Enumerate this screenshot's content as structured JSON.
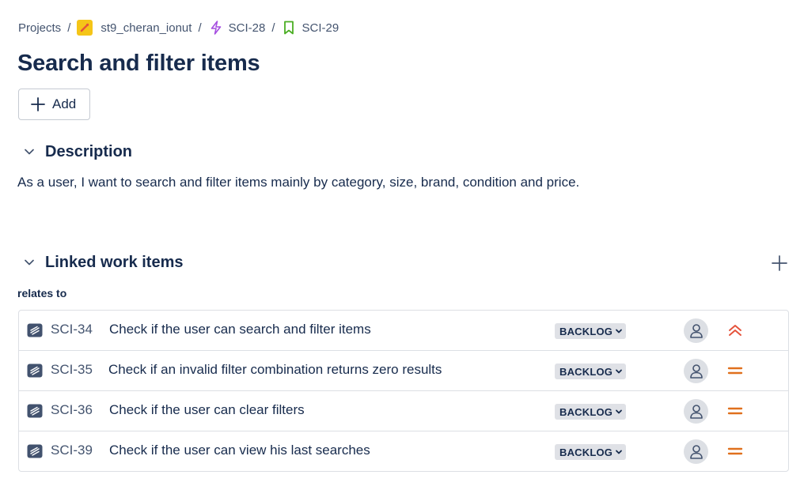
{
  "breadcrumb": {
    "projects": "Projects",
    "project": "st9_cheran_ionut",
    "epic": "SCI-28",
    "story": "SCI-29",
    "separator": "/"
  },
  "title": "Search and filter items",
  "add_button": {
    "label": "Add",
    "icon": "plus-icon"
  },
  "description": {
    "header": "Description",
    "text": "As a user, I want to search and filter items mainly by category, size, brand, condition and price."
  },
  "linked": {
    "header": "Linked work items",
    "relation": "relates to",
    "items": [
      {
        "key": "SCI-34",
        "summary": "Check if the user can search and filter items",
        "status": "BACKLOG",
        "priority": "high"
      },
      {
        "key": "SCI-35",
        "summary": "Check if an invalid filter combination returns zero results",
        "status": "BACKLOG",
        "priority": "medium"
      },
      {
        "key": "SCI-36",
        "summary": "Check if the user can clear filters",
        "status": "BACKLOG",
        "priority": "medium"
      },
      {
        "key": "SCI-39",
        "summary": "Check if the user can view his last searches",
        "status": "BACKLOG",
        "priority": "medium"
      }
    ]
  },
  "colors": {
    "text": "#172b4d",
    "subtle": "#44546f",
    "epic": "#a64fe0",
    "story": "#4bae23",
    "priority_high": "#e5533c",
    "priority_medium": "#e0701d",
    "project_icon_bg": "#f5c518"
  }
}
